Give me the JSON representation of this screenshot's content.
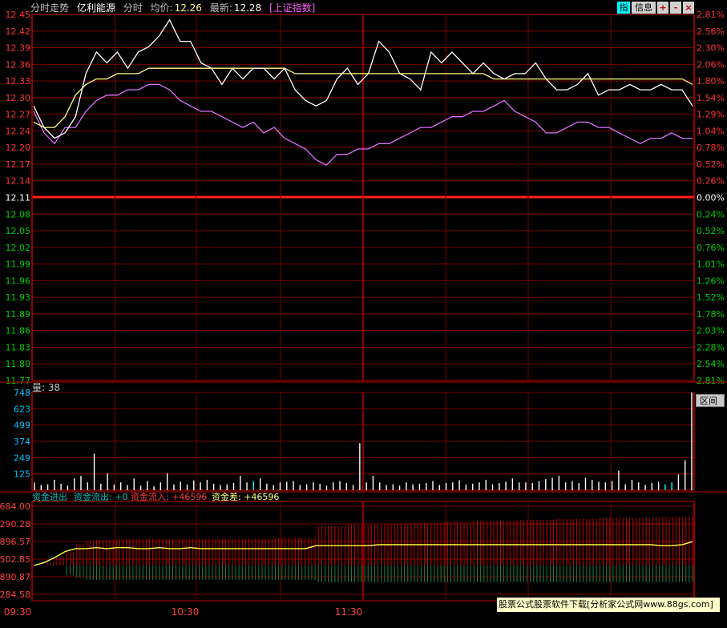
{
  "header": {
    "view": "分时走势",
    "stock_name": "亿利能源",
    "mode": "分时",
    "avg_label": "均价:",
    "avg_value": "12.26",
    "last_label": "最新:",
    "last_value": "12.28",
    "index_link": "[上证指数]"
  },
  "toolbar": {
    "index_btn": "指",
    "info_btn": "信息",
    "plus": "+",
    "minus": "-",
    "close": "×"
  },
  "colors": {
    "bg": "#000000",
    "grid": "#7a0000",
    "price": "#ffffff",
    "avg": "#ffff80",
    "strength": "#e070ff",
    "up": "#ff3232",
    "down": "#00d000",
    "vol": "#ffffff",
    "cyan": "#00ffff"
  },
  "chart_data": [
    {
      "type": "line",
      "title": "分时走势",
      "x_ticks": [
        "09:30",
        "10:30",
        "11:30"
      ],
      "ylim": [
        11.77,
        12.45
      ],
      "prev_close": "12.11",
      "y_ticks_left": [
        "12.45",
        "12.42",
        "12.39",
        "12.36",
        "12.33",
        "12.30",
        "12.27",
        "12.24",
        "12.20",
        "12.17",
        "12.14",
        "12.11",
        "12.08",
        "12.05",
        "12.02",
        "11.99",
        "11.96",
        "11.93",
        "11.89",
        "11.86",
        "11.83",
        "11.80",
        "11.77"
      ],
      "y_ticks_right": [
        "2.81%",
        "2.56%",
        "2.30%",
        "2.06%",
        "1.80%",
        "1.54%",
        "1.29%",
        "1.04%",
        "0.78%",
        "0.52%",
        "0.26%",
        "0.00%",
        "0.24%",
        "0.52%",
        "0.76%",
        "1.01%",
        "1.26%",
        "1.52%",
        "1.78%",
        "2.03%",
        "2.28%",
        "2.54%",
        "2.81%"
      ],
      "series": [
        {
          "values": [
            12.28,
            12.24,
            12.22,
            12.23,
            12.26,
            12.34,
            12.38,
            12.36,
            12.38,
            12.35,
            12.38,
            12.39,
            12.41,
            12.44,
            12.4,
            12.4,
            12.36,
            12.35,
            12.32,
            12.35,
            12.33,
            12.35,
            12.35,
            12.33,
            12.35,
            12.31,
            12.29,
            12.28,
            12.29,
            12.33,
            12.35,
            12.32,
            12.34,
            12.4,
            12.38,
            12.34,
            12.33,
            12.31,
            12.38,
            12.36,
            12.38,
            12.36,
            12.34,
            12.36,
            12.34,
            12.33,
            12.34,
            12.34,
            12.36,
            12.33,
            12.31,
            12.31,
            12.32,
            12.34,
            12.3,
            12.31,
            12.31,
            12.32,
            12.31,
            12.31,
            12.32,
            12.31,
            12.31,
            12.28
          ]
        },
        {
          "values": [
            12.25,
            12.24,
            12.24,
            12.26,
            12.3,
            12.32,
            12.33,
            12.33,
            12.34,
            12.34,
            12.34,
            12.35,
            12.35,
            12.35,
            12.35,
            12.35,
            12.35,
            12.35,
            12.35,
            12.35,
            12.35,
            12.35,
            12.35,
            12.35,
            12.35,
            12.34,
            12.34,
            12.34,
            12.34,
            12.34,
            12.34,
            12.34,
            12.34,
            12.34,
            12.34,
            12.34,
            12.34,
            12.34,
            12.34,
            12.34,
            12.34,
            12.34,
            12.34,
            12.34,
            12.33,
            12.33,
            12.33,
            12.33,
            12.33,
            12.33,
            12.33,
            12.33,
            12.33,
            12.33,
            12.33,
            12.33,
            12.33,
            12.33,
            12.33,
            12.33,
            12.33,
            12.33,
            12.33,
            12.32
          ]
        },
        {
          "values": [
            12.27,
            12.23,
            12.21,
            12.24,
            12.24,
            12.27,
            12.29,
            12.3,
            12.3,
            12.31,
            12.31,
            12.32,
            12.32,
            12.31,
            12.29,
            12.28,
            12.27,
            12.27,
            12.26,
            12.25,
            12.24,
            12.25,
            12.23,
            12.24,
            12.22,
            12.21,
            12.2,
            12.18,
            12.17,
            12.19,
            12.19,
            12.2,
            12.2,
            12.21,
            12.21,
            12.22,
            12.23,
            12.24,
            12.24,
            12.25,
            12.26,
            12.26,
            12.27,
            12.27,
            12.28,
            12.29,
            12.27,
            12.26,
            12.25,
            12.23,
            12.23,
            12.24,
            12.25,
            12.25,
            12.24,
            12.24,
            12.23,
            12.22,
            12.21,
            12.22,
            12.22,
            12.23,
            12.22,
            12.22
          ]
        }
      ]
    },
    {
      "type": "bar",
      "title": "量",
      "current": "38",
      "ylim": [
        0,
        748
      ],
      "y_ticks": [
        "748",
        "623",
        "499",
        "374",
        "249",
        "125"
      ],
      "values": [
        60,
        40,
        45,
        80,
        50,
        35,
        90,
        110,
        60,
        280,
        50,
        130,
        45,
        60,
        40,
        90,
        35,
        70,
        30,
        60,
        130,
        45,
        65,
        45,
        75,
        60,
        80,
        50,
        40,
        45,
        55,
        110,
        60,
        70,
        90,
        50,
        40,
        60,
        65,
        70,
        40,
        45,
        60,
        50,
        35,
        60,
        70,
        55,
        40,
        360,
        60,
        110,
        60,
        40,
        45,
        35,
        60,
        45,
        50,
        55,
        70,
        40,
        55,
        60,
        75,
        45,
        50,
        60,
        80,
        45,
        55,
        65,
        90,
        60,
        60,
        55,
        70,
        85,
        95,
        110,
        60,
        70,
        55,
        95,
        80,
        65,
        60,
        70,
        150,
        45,
        80,
        60,
        40,
        55,
        65,
        45,
        60,
        120,
        230,
        748
      ]
    },
    {
      "type": "bar",
      "title": "资金进出",
      "legend": [
        "资金流出: +0",
        "资金流入: +46596",
        "资金差: +46596"
      ],
      "y_ticks": [
        "684.00",
        "290.28",
        "896.57",
        "502.85",
        "890.87",
        "284.58"
      ],
      "ylim": [
        0,
        100
      ],
      "inflow_values": [
        0,
        3,
        8,
        14,
        22,
        25,
        26,
        26,
        27,
        27,
        27,
        27,
        27,
        27,
        27,
        27,
        27,
        27,
        27,
        27,
        27,
        27,
        27,
        28,
        28,
        28,
        28,
        40,
        40,
        40,
        41,
        41,
        41,
        42,
        42,
        42,
        43,
        43,
        43,
        44,
        44,
        44,
        45,
        45,
        45,
        45,
        46,
        46,
        46,
        46,
        47,
        47,
        47,
        47,
        48,
        48,
        48,
        48,
        48,
        49,
        49,
        49,
        49,
        50
      ],
      "outflow_values": [
        0,
        0,
        0,
        8,
        10,
        12,
        12,
        12,
        12,
        12,
        12,
        12,
        12,
        12,
        12,
        12,
        12,
        12,
        12,
        12,
        12,
        12,
        12,
        12,
        12,
        12,
        12,
        14,
        14,
        14,
        14,
        14,
        14,
        14,
        14,
        14,
        14,
        14,
        14,
        14,
        14,
        14,
        14,
        14,
        14,
        14,
        14,
        14,
        14,
        14,
        14,
        14,
        14,
        14,
        14,
        14,
        14,
        14,
        14,
        14,
        14,
        14,
        14,
        14
      ],
      "diff_line": [
        0,
        3,
        8,
        14,
        17,
        17,
        18,
        17,
        18,
        18,
        17,
        17,
        18,
        17,
        17,
        18,
        17,
        17,
        17,
        17,
        17,
        17,
        17,
        17,
        17,
        17,
        17,
        20,
        20,
        20,
        20,
        20,
        20,
        21,
        21,
        21,
        21,
        21,
        21,
        21,
        21,
        21,
        21,
        21,
        21,
        21,
        21,
        21,
        21,
        21,
        21,
        21,
        21,
        21,
        21,
        21,
        21,
        21,
        21,
        21,
        20,
        20,
        21,
        24
      ]
    }
  ],
  "footer": {
    "time_labels": [
      "09:30",
      "10:30",
      "11:30"
    ],
    "brand": "股票公式股票软件下载[分析家公式网www.88gs.com]",
    "qu_button": "区间"
  }
}
